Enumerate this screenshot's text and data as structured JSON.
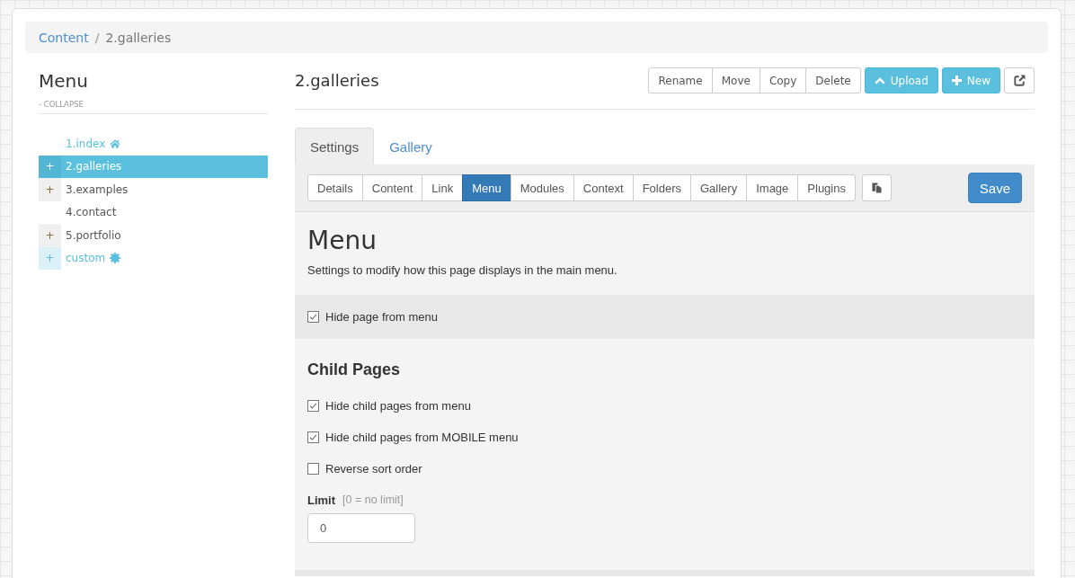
{
  "breadcrumb": {
    "items": [
      {
        "label": "Content",
        "current": false
      },
      {
        "label": "2.galleries",
        "current": true
      }
    ],
    "separator": "/"
  },
  "sidebar": {
    "title": "Menu",
    "collapse": "- COLLAPSE",
    "items": [
      {
        "label": "1.index",
        "kind": "home",
        "selected": false
      },
      {
        "label": "2.galleries",
        "kind": "page",
        "selected": true,
        "toggle": "+"
      },
      {
        "label": "3.examples",
        "kind": "page",
        "selected": false,
        "toggle": "+"
      },
      {
        "label": "4.contact",
        "kind": "page",
        "selected": false
      },
      {
        "label": "5.portfolio",
        "kind": "page",
        "selected": false,
        "toggle": "+"
      },
      {
        "label": "custom",
        "kind": "custom",
        "selected": false,
        "toggle": "+"
      }
    ]
  },
  "page": {
    "title": "2.galleries",
    "actions": [
      "Rename",
      "Move",
      "Copy",
      "Delete"
    ],
    "upload": "Upload",
    "new": "New"
  },
  "tabs": [
    {
      "label": "Settings",
      "selected": true
    },
    {
      "label": "Gallery",
      "selected": false
    }
  ],
  "section_tabs": [
    {
      "label": "Details",
      "selected": false
    },
    {
      "label": "Content",
      "selected": false
    },
    {
      "label": "Link",
      "selected": false
    },
    {
      "label": "Menu",
      "selected": true
    },
    {
      "label": "Modules",
      "selected": false
    },
    {
      "label": "Context",
      "selected": false
    },
    {
      "label": "Folders",
      "selected": false
    },
    {
      "label": "Gallery",
      "selected": false
    },
    {
      "label": "Image",
      "selected": false
    },
    {
      "label": "Plugins",
      "selected": false
    }
  ],
  "save_button": "Save",
  "panel": {
    "title": "Menu",
    "description": "Settings to modify how this page displays in the main menu.",
    "hide_page": {
      "label": "Hide page from menu",
      "checked": true
    },
    "child_pages": {
      "title": "Child Pages",
      "options": [
        {
          "label": "Hide child pages from menu",
          "checked": true
        },
        {
          "label": "Hide child pages from MOBILE menu",
          "checked": true
        },
        {
          "label": "Reverse sort order",
          "checked": false
        }
      ]
    },
    "limit": {
      "label": "Limit",
      "hint": "[0 = no limit]",
      "value": "0"
    }
  }
}
